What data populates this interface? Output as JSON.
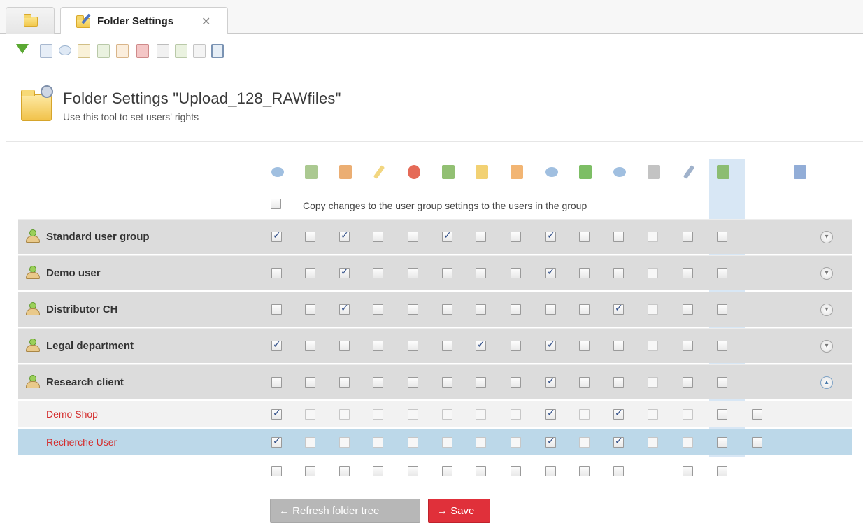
{
  "tabs": [
    {
      "id": "home",
      "label": ""
    },
    {
      "id": "folder-settings",
      "label": "Folder Settings",
      "close": "✕"
    }
  ],
  "header": {
    "title": "Folder Settings \"Upload_128_RAWfiles\"",
    "subtitle": "Use this tool to set users' rights"
  },
  "toolbar": {
    "icons": [
      "download-arrow-icon",
      "cart-icon",
      "view-icon",
      "edit-doc-icon",
      "export-doc-icon",
      "new-doc-icon",
      "delete-doc-icon",
      "document-icon",
      "copy-doc-icon",
      "blank-doc-icon",
      "window-icon"
    ]
  },
  "columns": {
    "icons": [
      "eye-icon",
      "add-file-icon",
      "remove-file-icon",
      "pencil-icon",
      "delete-icon",
      "folder-add-icon",
      "folder-edit-icon",
      "folder-delete-icon",
      "folder-view-icon",
      "folder-share-icon",
      "folder-eye-icon",
      "trash-icon",
      "wrench-icon",
      "download-settings-icon",
      "edit-settings-icon"
    ],
    "copy_label": "Copy changes to the user group settings to the users in the group"
  },
  "groups": [
    {
      "name": "Standard user group",
      "checks": [
        1,
        0,
        1,
        0,
        0,
        1,
        0,
        0,
        1,
        0,
        0,
        0,
        0,
        0
      ],
      "expanded": false
    },
    {
      "name": "Demo user",
      "checks": [
        0,
        0,
        1,
        0,
        0,
        0,
        0,
        0,
        1,
        0,
        0,
        0,
        0,
        0
      ],
      "expanded": false
    },
    {
      "name": "Distributor CH",
      "checks": [
        0,
        0,
        1,
        0,
        0,
        0,
        0,
        0,
        0,
        0,
        1,
        0,
        0,
        0
      ],
      "expanded": false
    },
    {
      "name": "Legal department",
      "checks": [
        1,
        0,
        0,
        0,
        0,
        0,
        1,
        0,
        1,
        0,
        0,
        0,
        0,
        0
      ],
      "expanded": false
    },
    {
      "name": "Research client",
      "checks": [
        0,
        0,
        0,
        0,
        0,
        0,
        0,
        0,
        1,
        0,
        0,
        0,
        0,
        0
      ],
      "expanded": true
    }
  ],
  "users": [
    {
      "name": "Demo Shop",
      "checks": [
        1,
        0,
        0,
        0,
        0,
        0,
        0,
        0,
        1,
        0,
        1,
        0,
        0,
        0,
        0
      ],
      "selected": false
    },
    {
      "name": "Recherche User",
      "checks": [
        1,
        0,
        0,
        0,
        0,
        0,
        0,
        0,
        1,
        0,
        1,
        0,
        0,
        0,
        0
      ],
      "selected": true
    }
  ],
  "blank_row_checks": [
    0,
    0,
    0,
    0,
    0,
    0,
    0,
    0,
    0,
    0,
    0,
    0,
    0
  ],
  "buttons": {
    "refresh": "← Refresh folder tree",
    "save": "→ Save"
  },
  "colors": {
    "accent_red": "#e0303a",
    "group_row_bg": "#dcdcdc",
    "selected_row_bg": "#bcd8e9",
    "column_highlight": "#d8e7f5",
    "user_name": "#d42d2d"
  }
}
